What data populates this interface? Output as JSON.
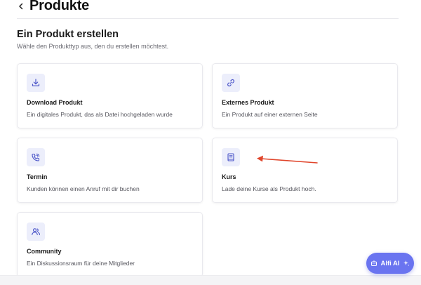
{
  "header": {
    "title": "Produkte"
  },
  "section": {
    "title": "Ein Produkt erstellen",
    "subtitle": "Wähle den Produkttyp aus, den du erstellen möchtest."
  },
  "cards": [
    {
      "icon": "download-icon",
      "title": "Download Produkt",
      "description": "Ein digitales Produkt, das als Datei hochgeladen wurde"
    },
    {
      "icon": "link-icon",
      "title": "Externes Produkt",
      "description": "Ein Produkt auf einer externen Seite"
    },
    {
      "icon": "phone-call-icon",
      "title": "Termin",
      "description": "Kunden können einen Anruf mit dir buchen"
    },
    {
      "icon": "book-icon",
      "title": "Kurs",
      "description": "Lade deine Kurse als Produkt hoch."
    },
    {
      "icon": "users-icon",
      "title": "Community",
      "description": "Ein Diskussionsraum für deine Mitglieder"
    }
  ],
  "ai_button": {
    "label": "Alfi AI"
  },
  "colors": {
    "accent": "#6a74f0",
    "icon": "#4b55c8",
    "icon_bg": "#eceefb",
    "annotation_arrow": "#e0452b"
  }
}
